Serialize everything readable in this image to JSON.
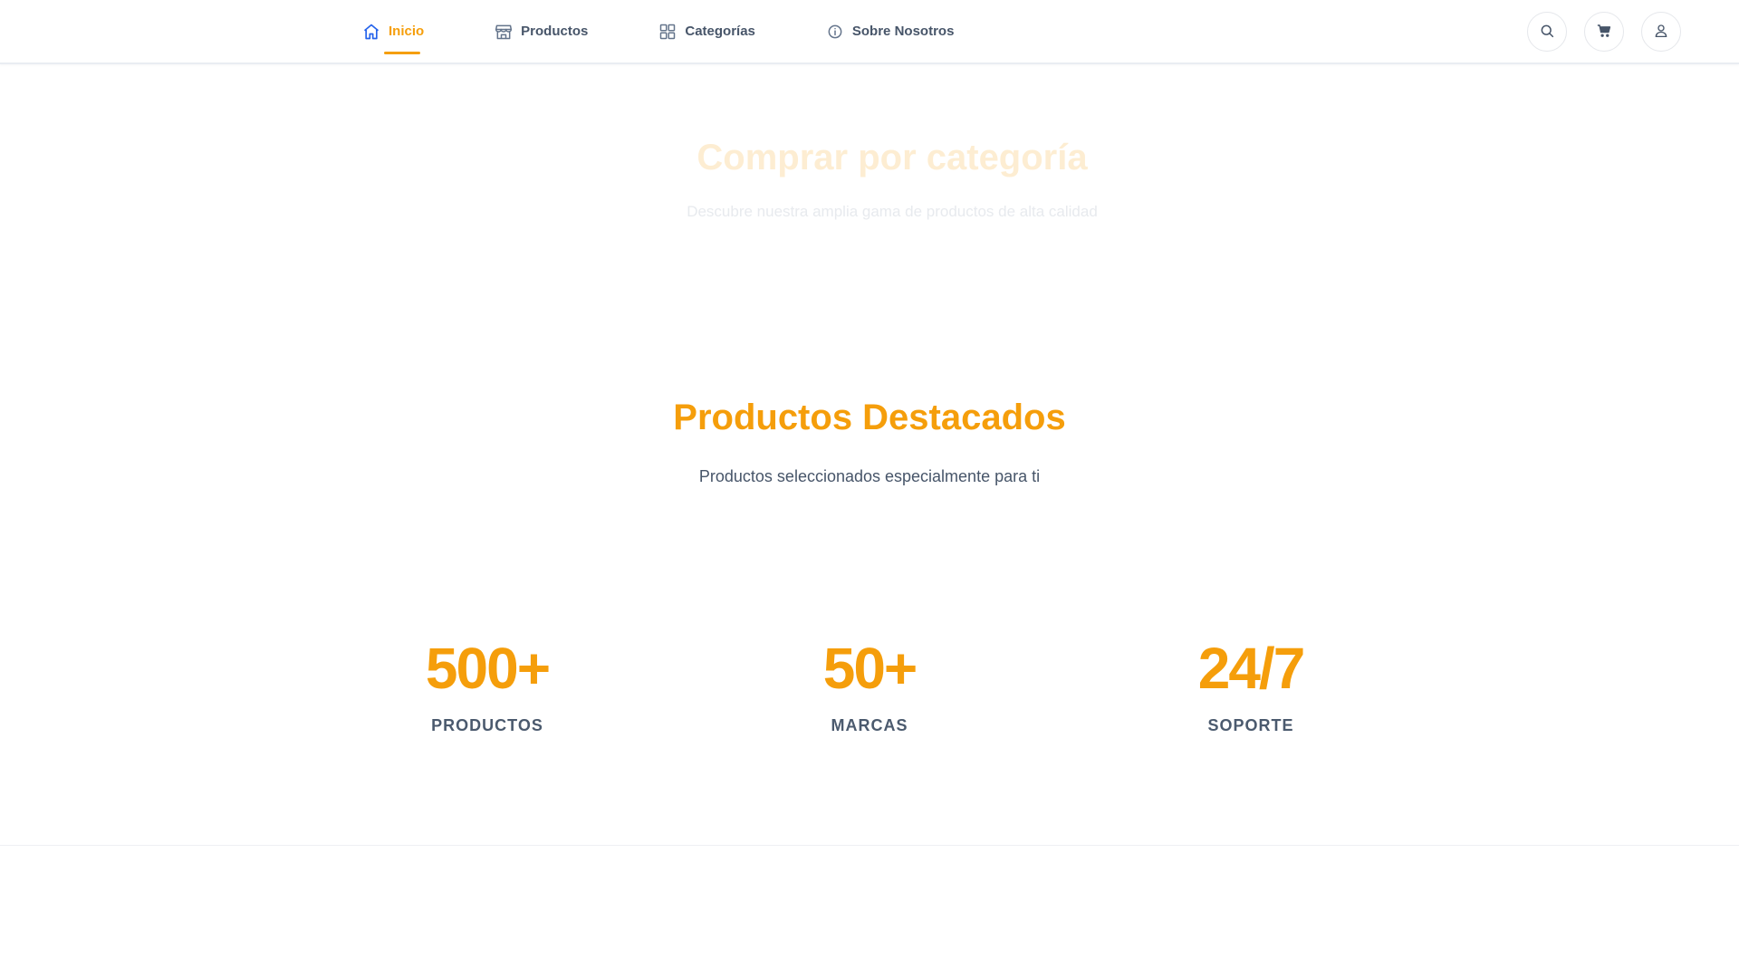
{
  "nav": {
    "items": [
      {
        "label": "Inicio",
        "icon": "home-icon",
        "active": true
      },
      {
        "label": "Productos",
        "icon": "store-icon",
        "active": false
      },
      {
        "label": "Categorías",
        "icon": "grid-icon",
        "active": false
      },
      {
        "label": "Sobre Nosotros",
        "icon": "info-icon",
        "active": false
      }
    ],
    "actions": [
      "search-icon",
      "cart-icon",
      "user-icon"
    ]
  },
  "categories": {
    "title": "Comprar por categoría",
    "subtitle": "Descubre nuestra amplia gama de productos de alta calidad"
  },
  "featured": {
    "title": "Productos Destacados",
    "subtitle": "Productos seleccionados especialmente para ti"
  },
  "stats": [
    {
      "value": "500+",
      "label": "PRODUCTOS"
    },
    {
      "value": "50+",
      "label": "MARCAS"
    },
    {
      "value": "24/7",
      "label": "SOPORTE"
    }
  ],
  "colors": {
    "accent": "#f59e0b",
    "active_icon": "#2563eb",
    "text": "#475569",
    "border": "#e5e7eb"
  }
}
